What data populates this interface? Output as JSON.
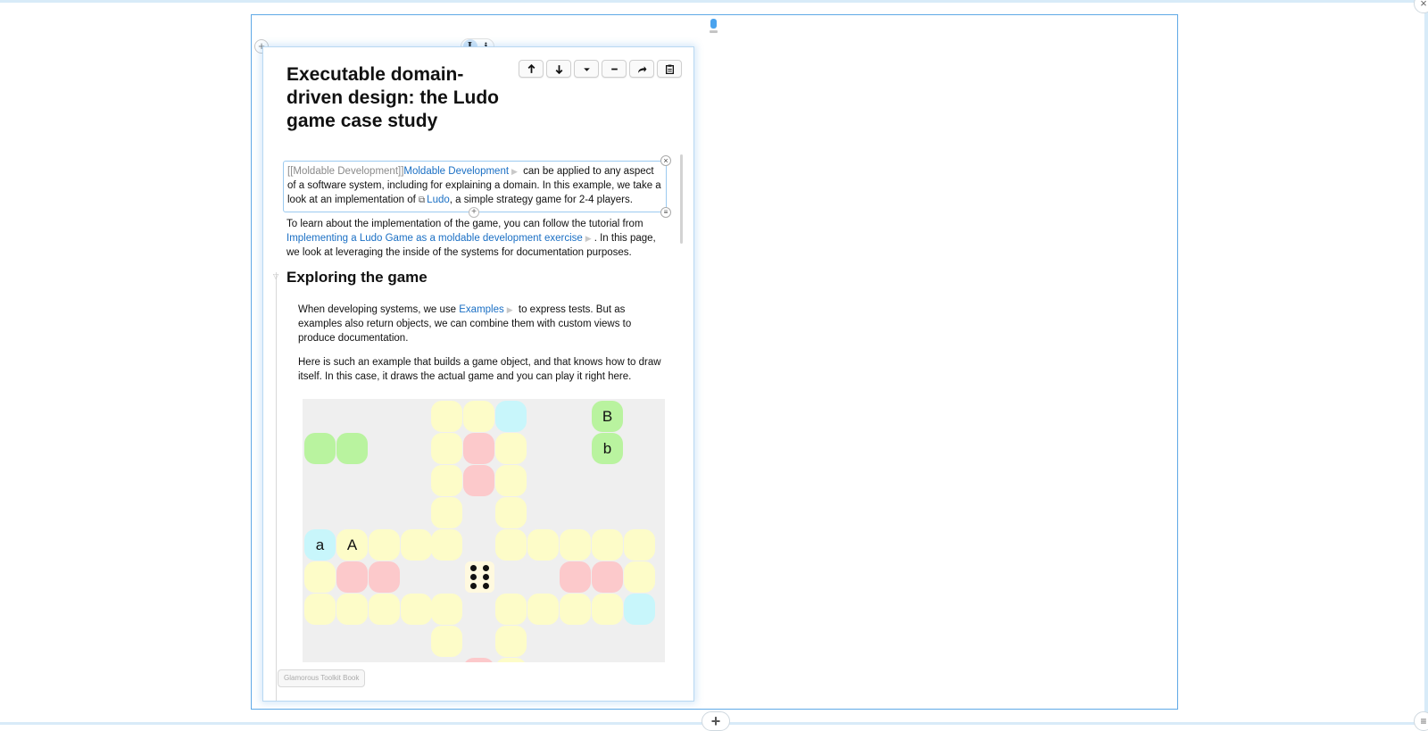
{
  "page": {
    "title": "Executable domain-driven design: the Ludo game case study",
    "mode": {
      "active": "I",
      "inactive": "i"
    },
    "footer_label": "Glamorous Toolkit Book"
  },
  "toolbar": {
    "move_up": "move-up-icon",
    "move_down": "move-down-icon",
    "dropdown": "dropdown-icon",
    "remove": "remove-icon",
    "share": "share-icon",
    "clipboard": "clipboard-icon"
  },
  "world": {
    "add_label": "+",
    "close_label": "×",
    "menu_label": "≡"
  },
  "snippet": {
    "markup": "[[Moldable Development]]",
    "link": "Moldable Development",
    "text1": " can be applied to any aspect of a software system, including for explaining a domain. In this example, we take a look at an implementation of ",
    "ext_link": "Ludo",
    "text2": ", a simple strategy game for 2-4 players."
  },
  "para1": {
    "text1": "To learn about the implementation of the game, you can follow the tutorial from ",
    "link": "Implementing a Ludo Game as a moldable development exercise",
    "text2": ". In this page, we look at leveraging the inside of the systems for documentation purposes."
  },
  "section": {
    "heading": "Exploring the game"
  },
  "para2": {
    "text1": "When developing systems, we use ",
    "link": "Examples",
    "text2": " to express tests. But as examples also return objects, we can combine them with custom views to produce documentation."
  },
  "para3": {
    "text": "Here is such an example that builds a game object, and that knows how to draw itself. In this case, it draws the actual game and you can play it right here."
  },
  "board": {
    "colors": {
      "track": "#fdfcc8",
      "green": "#b9f39f",
      "cyan": "#c8f6fb",
      "red": "#fcc9cb",
      "background": "#efefef",
      "die": "#fff9df"
    },
    "labels": {
      "B": "B",
      "b": "b",
      "a": "a",
      "A": "A"
    },
    "die_value": 6
  }
}
